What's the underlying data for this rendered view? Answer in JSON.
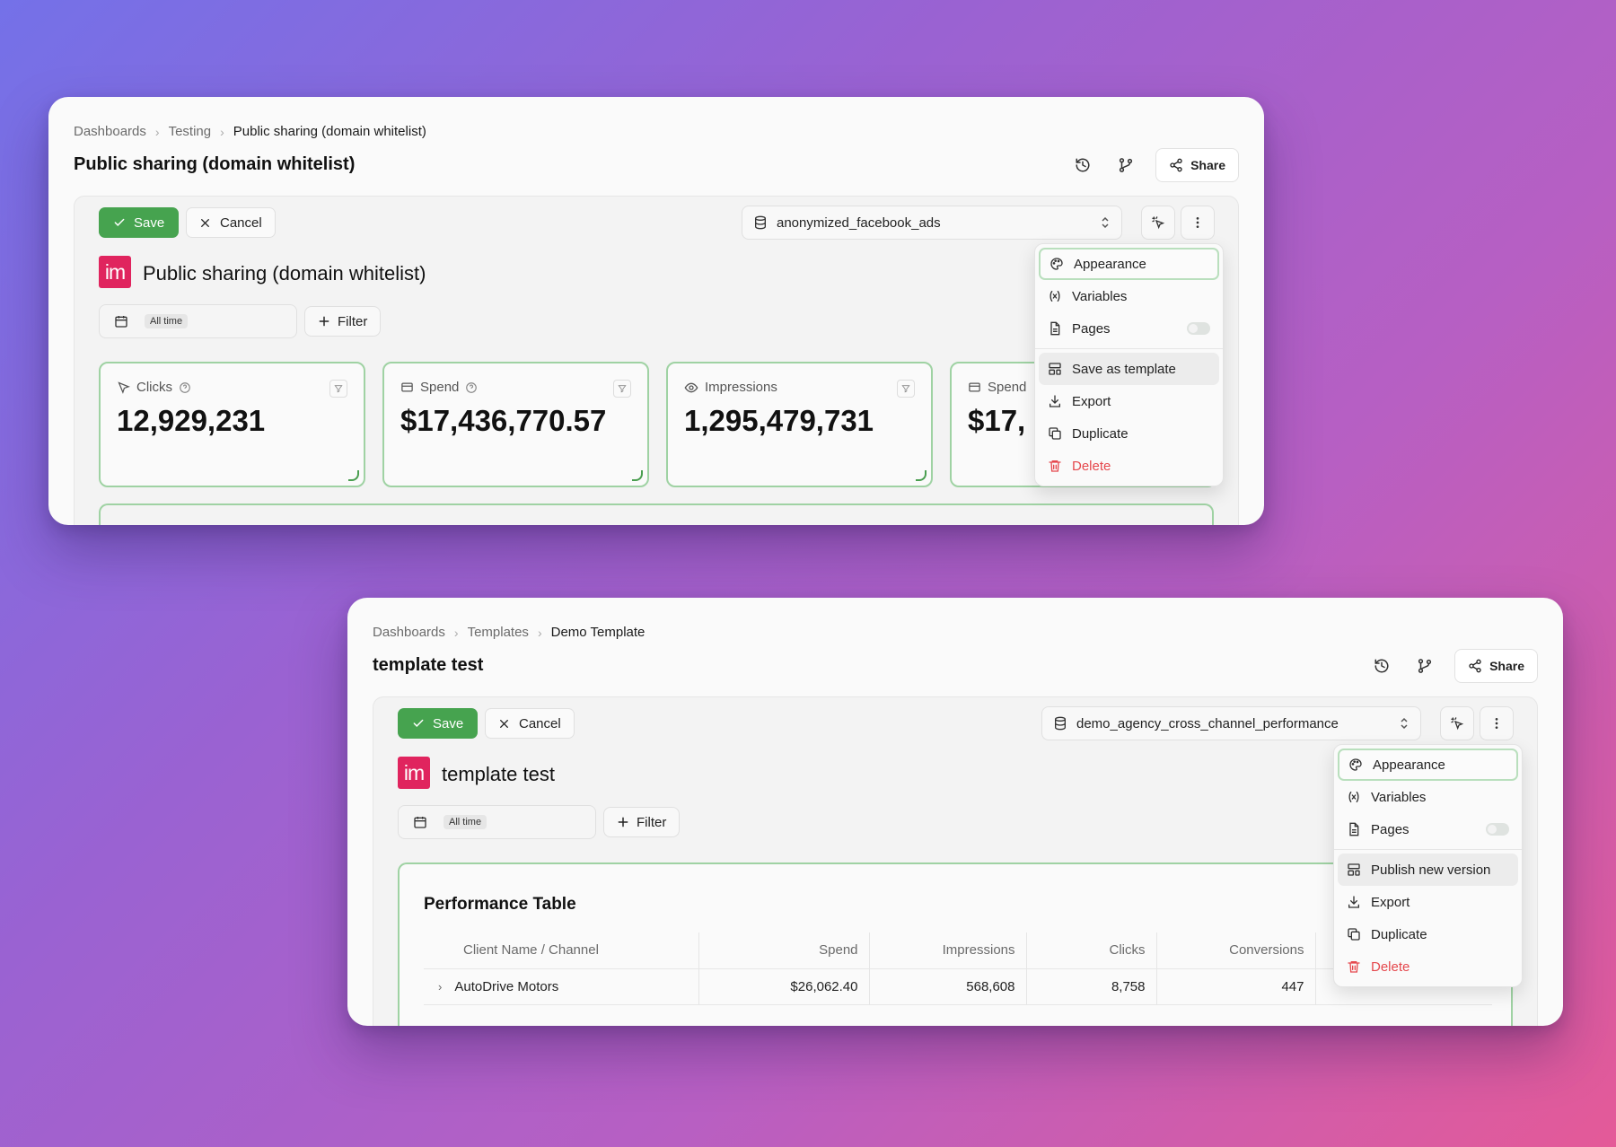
{
  "window1": {
    "breadcrumbs": [
      "Dashboards",
      "Testing",
      "Public sharing (domain whitelist)"
    ],
    "page_title": "Public sharing (domain whitelist)",
    "share_label": "Share",
    "save_label": "Save",
    "cancel_label": "Cancel",
    "datasource": "anonymized_facebook_ads",
    "logo_text": "im",
    "dashboard_title": "Public sharing (domain whitelist)",
    "date_range": "All time",
    "filter_label": "Filter",
    "kpis": [
      {
        "label": "Clicks",
        "value": "12,929,231",
        "icon": "cursor-icon"
      },
      {
        "label": "Spend",
        "value": "$17,436,770.57",
        "icon": "card-icon"
      },
      {
        "label": "Impressions",
        "value": "1,295,479,731",
        "icon": "eye-icon"
      },
      {
        "label": "Spend",
        "value": "$17,",
        "icon": "card-icon"
      }
    ],
    "menu": {
      "appearance": "Appearance",
      "variables": "Variables",
      "pages": "Pages",
      "template_action": "Save as template",
      "export": "Export",
      "duplicate": "Duplicate",
      "delete": "Delete"
    }
  },
  "window2": {
    "breadcrumbs": [
      "Dashboards",
      "Templates",
      "Demo Template"
    ],
    "page_title": "template test",
    "share_label": "Share",
    "save_label": "Save",
    "cancel_label": "Cancel",
    "datasource": "demo_agency_cross_channel_performance",
    "logo_text": "im",
    "dashboard_title": "template test",
    "date_range": "All time",
    "filter_label": "Filter",
    "table": {
      "title": "Performance Table",
      "columns": [
        "Client Name / Channel",
        "Spend",
        "Impressions",
        "Clicks",
        "Conversions",
        ""
      ],
      "rows": [
        [
          "AutoDrive Motors",
          "$26,062.40",
          "568,608",
          "8,758",
          "447",
          ""
        ]
      ]
    },
    "menu": {
      "appearance": "Appearance",
      "variables": "Variables",
      "pages": "Pages",
      "template_action": "Publish new version",
      "export": "Export",
      "duplicate": "Duplicate",
      "delete": "Delete"
    }
  },
  "colors": {
    "accent_green": "#46a34f",
    "panel_border_green": "#9fd2a3",
    "logo_pink": "#e0245e",
    "danger_red": "#e5484d"
  }
}
